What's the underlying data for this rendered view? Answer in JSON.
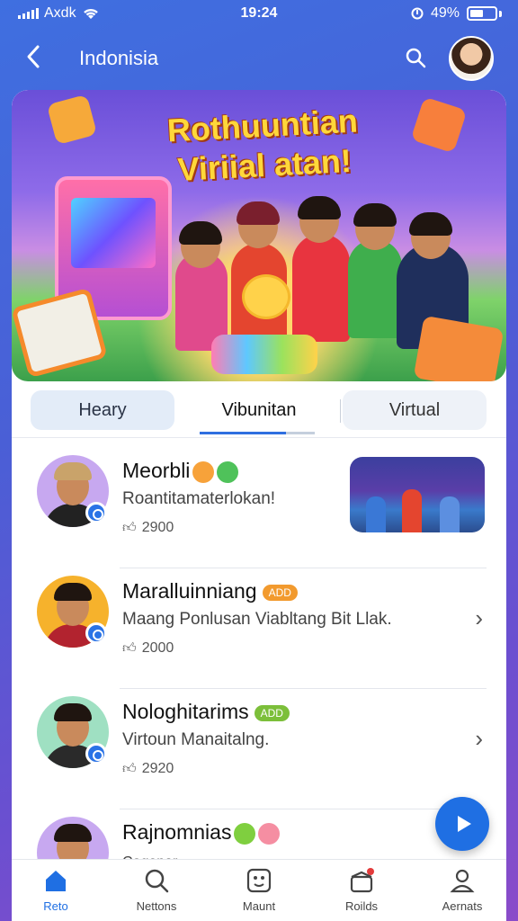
{
  "status_bar": {
    "carrier": "Axdk",
    "time": "19:24",
    "battery": "49%"
  },
  "header": {
    "title": "Indonisia"
  },
  "banner": {
    "title": "Rothuuntian Viriial atan!"
  },
  "tabs": [
    {
      "label": "Heary"
    },
    {
      "label": "Vibunitan"
    },
    {
      "label": "Virtual"
    }
  ],
  "list": [
    {
      "name": "Meorbli",
      "subtitle": "Roantitamaterlokan!",
      "likes": "2900",
      "avatar_bg": "#c7a8f0",
      "body_color": "#222"
    },
    {
      "name": "Maralluinniang",
      "badge": "ADD",
      "badge_color": "#f29a2e",
      "subtitle": "Maang Ponlusan Viabltang Bit Llak.",
      "likes": "2000",
      "avatar_bg": "#f6b22c",
      "body_color": "#b2232f"
    },
    {
      "name": "Nologhitarims",
      "badge": "ADD",
      "badge_color": "#7cbf3a",
      "subtitle": "Virtoun Manaitalng.",
      "likes": "2920",
      "avatar_bg": "#9fe0c2",
      "body_color": "#2a2a2a"
    },
    {
      "name": "Rajnomnias",
      "subtitle": "Cogenar",
      "likes": "",
      "avatar_bg": "#c7a8f0",
      "body_color": "#333"
    }
  ],
  "bottom_nav": [
    {
      "label": "Reto",
      "icon": "home-icon"
    },
    {
      "label": "Nettons",
      "icon": "search-icon"
    },
    {
      "label": "Maunt",
      "icon": "face-icon"
    },
    {
      "label": "Roilds",
      "icon": "gift-icon"
    },
    {
      "label": "Aernats",
      "icon": "person-icon"
    }
  ],
  "colors": {
    "accent": "#1f6fe3",
    "background_top": "#3f6fe0",
    "background_bottom": "#8a4cc9"
  }
}
